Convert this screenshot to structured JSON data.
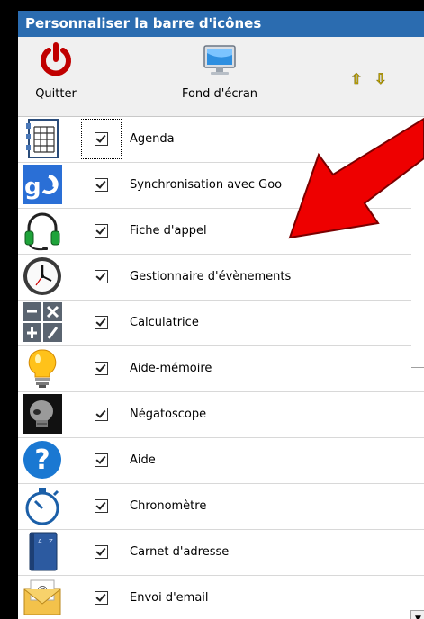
{
  "window": {
    "title": "Personnaliser la barre d'icônes"
  },
  "toolbar": {
    "quit_label": "Quitter",
    "wallpaper_label": "Fond d'écran",
    "up_arrow": "⇧",
    "down_arrow": "⇩"
  },
  "items": [
    {
      "label": "Agenda",
      "icon": "agenda-icon",
      "checked": true
    },
    {
      "label": "Synchronisation avec Goo",
      "icon": "sync-google-icon",
      "checked": true
    },
    {
      "label": "Fiche d'appel",
      "icon": "headset-icon",
      "checked": true
    },
    {
      "label": "Gestionnaire d'évènements",
      "icon": "clock-icon",
      "checked": true
    },
    {
      "label": "Calculatrice",
      "icon": "calculator-icon",
      "checked": true
    },
    {
      "label": "Aide-mémoire",
      "icon": "lightbulb-icon",
      "checked": true
    },
    {
      "label": "Négatoscope",
      "icon": "xray-skull-icon",
      "checked": true
    },
    {
      "label": "Aide",
      "icon": "help-icon",
      "checked": true
    },
    {
      "label": "Chronomètre",
      "icon": "stopwatch-icon",
      "checked": true
    },
    {
      "label": "Carnet d'adresse",
      "icon": "address-book-icon",
      "checked": true
    },
    {
      "label": "Envoi d'email",
      "icon": "email-icon",
      "checked": true
    }
  ],
  "colors": {
    "title_bg": "#2b6cb0",
    "arrow_red": "#ee0000"
  }
}
